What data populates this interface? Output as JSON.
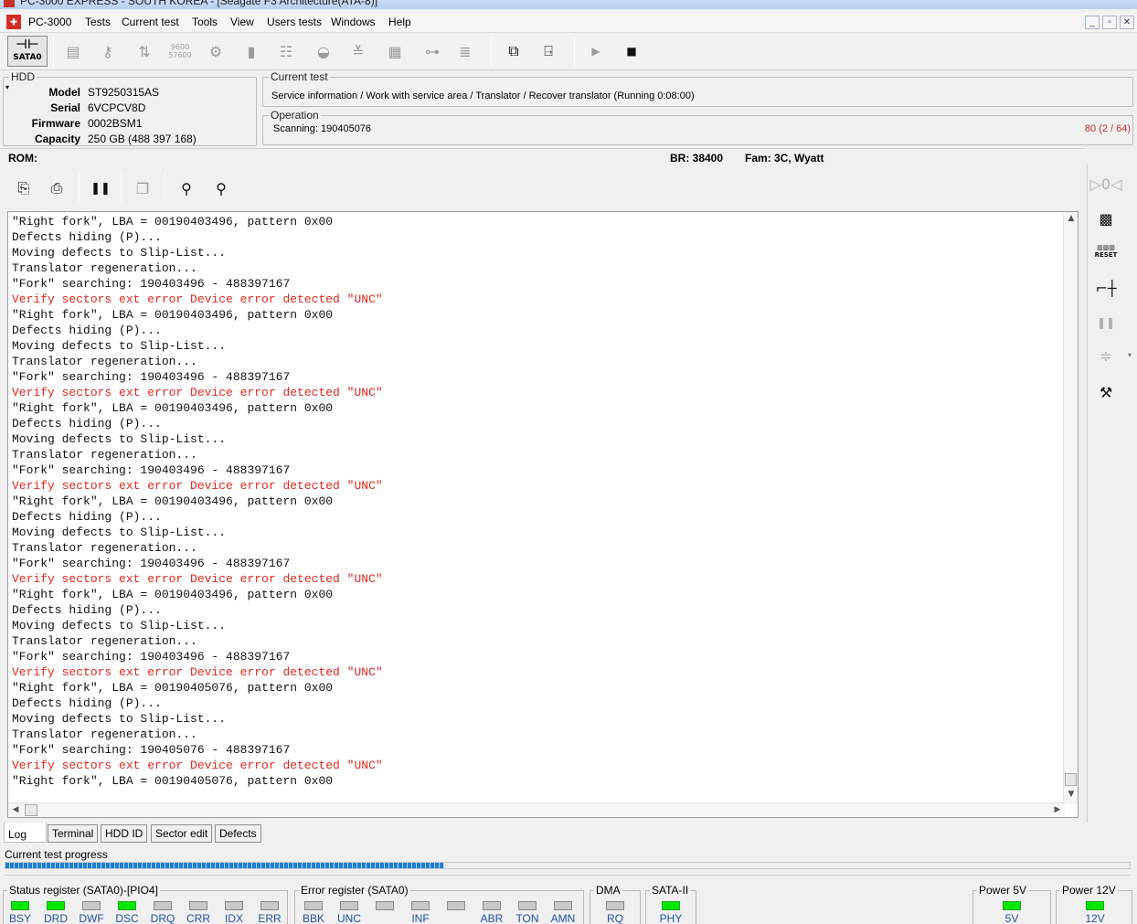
{
  "window": {
    "title": "PC-3000 EXPRESS - SOUTH KOREA - [Seagate F3 Architecture(ATA-8)]"
  },
  "menu": [
    "PC-3000",
    "Tests",
    "Current test",
    "Tools",
    "View",
    "Users tests",
    "Windows",
    "Help"
  ],
  "toolbar": {
    "sata_label": "SATA0",
    "baud_top": "9600",
    "baud_bottom": "57600"
  },
  "hdd": {
    "group_label": "HDD",
    "model_label": "Model",
    "model": "ST9250315AS",
    "serial_label": "Serial",
    "serial": "6VCPCV8D",
    "firmware_label": "Firmware",
    "firmware": "0002BSM1",
    "capacity_label": "Capacity",
    "capacity": "250 GB (488 397 168)"
  },
  "current_test": {
    "group_label": "Current test",
    "text": "Service information / Work with service area / Translator / Recover translator (Running 0:08:00)"
  },
  "operation": {
    "group_label": "Operation",
    "text": "Scanning: 190405076",
    "counter": "80 (2 / 64)"
  },
  "rom_bar": {
    "rom": "ROM:",
    "br": "BR: 38400",
    "fam": "Fam: 3C, Wyatt"
  },
  "log": [
    {
      "text": "\"Right fork\", LBA = 00190403496, pattern 0x00",
      "err": false
    },
    {
      "text": "Defects hiding (P)...",
      "err": false
    },
    {
      "text": "Moving defects to Slip-List...",
      "err": false
    },
    {
      "text": "Translator regeneration...",
      "err": false
    },
    {
      "text": "\"Fork\" searching: 190403496 - 488397167",
      "err": false
    },
    {
      "text": "Verify sectors ext error Device error detected \"UNC\"",
      "err": true
    },
    {
      "text": "\"Right fork\", LBA = 00190403496, pattern 0x00",
      "err": false
    },
    {
      "text": "Defects hiding (P)...",
      "err": false
    },
    {
      "text": "Moving defects to Slip-List...",
      "err": false
    },
    {
      "text": "Translator regeneration...",
      "err": false
    },
    {
      "text": "\"Fork\" searching: 190403496 - 488397167",
      "err": false
    },
    {
      "text": "Verify sectors ext error Device error detected \"UNC\"",
      "err": true
    },
    {
      "text": "\"Right fork\", LBA = 00190403496, pattern 0x00",
      "err": false
    },
    {
      "text": "Defects hiding (P)...",
      "err": false
    },
    {
      "text": "Moving defects to Slip-List...",
      "err": false
    },
    {
      "text": "Translator regeneration...",
      "err": false
    },
    {
      "text": "\"Fork\" searching: 190403496 - 488397167",
      "err": false
    },
    {
      "text": "Verify sectors ext error Device error detected \"UNC\"",
      "err": true
    },
    {
      "text": "\"Right fork\", LBA = 00190403496, pattern 0x00",
      "err": false
    },
    {
      "text": "Defects hiding (P)...",
      "err": false
    },
    {
      "text": "Moving defects to Slip-List...",
      "err": false
    },
    {
      "text": "Translator regeneration...",
      "err": false
    },
    {
      "text": "\"Fork\" searching: 190403496 - 488397167",
      "err": false
    },
    {
      "text": "Verify sectors ext error Device error detected \"UNC\"",
      "err": true
    },
    {
      "text": "\"Right fork\", LBA = 00190403496, pattern 0x00",
      "err": false
    },
    {
      "text": "Defects hiding (P)...",
      "err": false
    },
    {
      "text": "Moving defects to Slip-List...",
      "err": false
    },
    {
      "text": "Translator regeneration...",
      "err": false
    },
    {
      "text": "\"Fork\" searching: 190403496 - 488397167",
      "err": false
    },
    {
      "text": "Verify sectors ext error Device error detected \"UNC\"",
      "err": true
    },
    {
      "text": "\"Right fork\", LBA = 00190405076, pattern 0x00",
      "err": false
    },
    {
      "text": "Defects hiding (P)...",
      "err": false
    },
    {
      "text": "Moving defects to Slip-List...",
      "err": false
    },
    {
      "text": "Translator regeneration...",
      "err": false
    },
    {
      "text": "\"Fork\" searching: 190405076 - 488397167",
      "err": false
    },
    {
      "text": "Verify sectors ext error Device error detected \"UNC\"",
      "err": true
    },
    {
      "text": "\"Right fork\", LBA = 00190405076, pattern 0x00",
      "err": false
    }
  ],
  "sidebar": {
    "reset_label": "RESET"
  },
  "tabs": [
    "Log",
    "Terminal",
    "HDD ID",
    "Sector edit",
    "Defects"
  ],
  "progress": {
    "label": "Current test progress",
    "fraction": 0.39
  },
  "status_register": {
    "title": "Status register (SATA0)-[PIO4]",
    "bits": [
      {
        "name": "BSY",
        "on": true
      },
      {
        "name": "DRD",
        "on": true
      },
      {
        "name": "DWF",
        "on": false
      },
      {
        "name": "DSC",
        "on": true
      },
      {
        "name": "DRQ",
        "on": false
      },
      {
        "name": "CRR",
        "on": false
      },
      {
        "name": "IDX",
        "on": false
      },
      {
        "name": "ERR",
        "on": false
      }
    ]
  },
  "error_register": {
    "title": "Error register (SATA0)",
    "bits": [
      {
        "name": "BBK",
        "on": false
      },
      {
        "name": "UNC",
        "on": false
      },
      {
        "name": "",
        "on": false
      },
      {
        "name": "INF",
        "on": false
      },
      {
        "name": "",
        "on": false
      },
      {
        "name": "ABR",
        "on": false
      },
      {
        "name": "TON",
        "on": false
      },
      {
        "name": "AMN",
        "on": false
      }
    ]
  },
  "dma": {
    "title": "DMA",
    "bit": "RQ",
    "on": false
  },
  "sata2": {
    "title": "SATA-II",
    "bit": "PHY",
    "on": true
  },
  "power5": {
    "title": "Power 5V",
    "bit": "5V",
    "on": true
  },
  "power12": {
    "title": "Power 12V",
    "bit": "12V",
    "on": true
  },
  "colors": {
    "error_text": "#e3261d",
    "led_on": "#00e800",
    "progress": "#1e7fd6"
  }
}
